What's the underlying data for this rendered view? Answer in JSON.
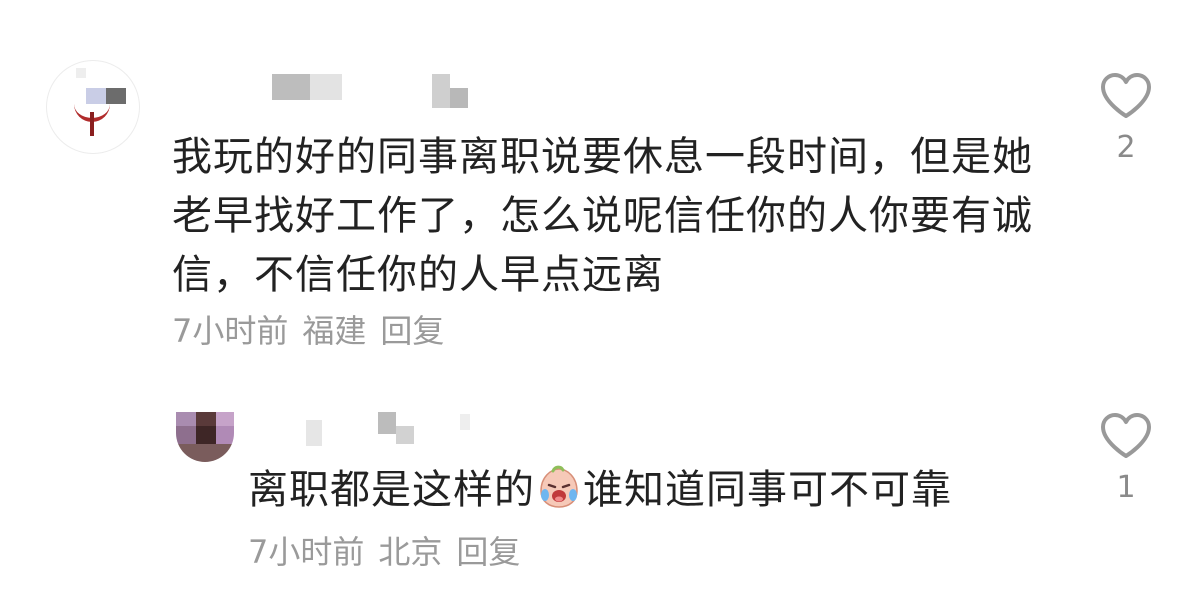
{
  "comments": [
    {
      "text": "我玩的好的同事离职说要休息一段时间，但是她老早找好工作了，怎么说呢信任你的人你要有诚信，不信任你的人早点远离",
      "time": "7小时前",
      "location": "福建",
      "reply_label": "回复",
      "like_count": "2",
      "icons": {
        "like": "heart-outline-icon",
        "avatar": "avatar-logo-icon"
      }
    },
    {
      "text_before_emoji": "离职都是这样的",
      "text_after_emoji": "谁知道同事可不可靠",
      "time": "7小时前",
      "location": "北京",
      "reply_label": "回复",
      "like_count": "1",
      "icons": {
        "like": "heart-outline-icon",
        "emoji": "crying-laughing-face-emoji"
      }
    }
  ],
  "colors": {
    "text": "#222222",
    "meta": "#9a9a9a",
    "like_icon": "#999999"
  }
}
